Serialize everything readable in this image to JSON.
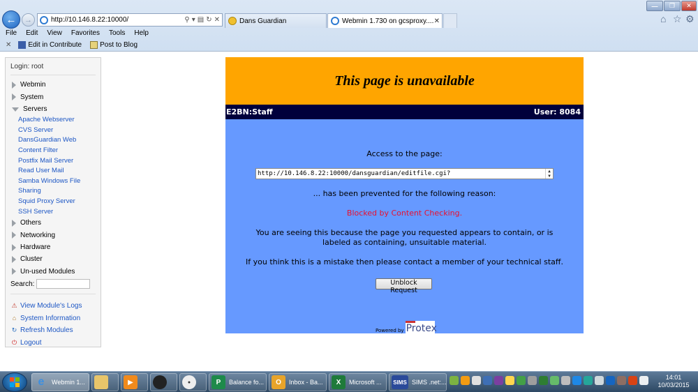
{
  "browser": {
    "address_url": "http://10.146.8.22:10000/",
    "tabs": [
      {
        "label": "Dans Guardian",
        "active": false
      },
      {
        "label": "Webmin 1.730 on gcsproxy....",
        "active": true
      }
    ],
    "menu": [
      "File",
      "Edit",
      "View",
      "Favorites",
      "Tools",
      "Help"
    ],
    "favorites": [
      "Edit in Contribute",
      "Post to Blog"
    ]
  },
  "sidebar": {
    "login": "Login: root",
    "categories_top": [
      {
        "label": "Webmin",
        "open": false
      },
      {
        "label": "System",
        "open": false
      },
      {
        "label": "Servers",
        "open": true
      }
    ],
    "server_items": [
      "Apache Webserver",
      "CVS Server",
      "DansGuardian Web",
      "Content Filter",
      "Postfix Mail Server",
      "Read User Mail",
      "Samba Windows File",
      "Sharing",
      "Squid Proxy Server",
      "SSH Server"
    ],
    "categories_bottom": [
      {
        "label": "Others"
      },
      {
        "label": "Networking"
      },
      {
        "label": "Hardware"
      },
      {
        "label": "Cluster"
      },
      {
        "label": "Un-used Modules"
      }
    ],
    "search_label": "Search:",
    "tools": [
      {
        "label": "View Module's Logs",
        "icon": "warning-icon"
      },
      {
        "label": "System Information",
        "icon": "home-icon"
      },
      {
        "label": "Refresh Modules",
        "icon": "refresh-icon"
      },
      {
        "label": "Logout",
        "icon": "power-icon"
      }
    ]
  },
  "block_page": {
    "title": "This page is unavailable",
    "bar_left": "E2BN:Staff",
    "bar_right": "User: 8084",
    "access_text": "Access to the page:",
    "blocked_url": "http://10.146.8.22:10000/dansguardian/editfile.cgi?",
    "prevented_text": "... has been prevented for the following reason:",
    "reason": "Blocked by Content Checking.",
    "explanation": "You are seeing this because the page you requested appears to contain, or is labeled as containing, unsuitable material.",
    "mistake_text": "If you think this is a mistake then please contact a member of your technical staff.",
    "unblock_label": "Unblock Request",
    "powered_by": "Powered by",
    "logo_text": "Protex",
    "colors": {
      "header": "#ffa500",
      "bar": "#00003b",
      "body": "#6699ff",
      "reason": "#e8102f"
    }
  },
  "taskbar": {
    "buttons": [
      {
        "label": "Webmin 1...",
        "icon": "ie-icon",
        "active": true
      },
      {
        "label": "",
        "icon": "folder-icon"
      },
      {
        "label": "",
        "icon": "media-icon"
      },
      {
        "label": "",
        "icon": "app-icon"
      },
      {
        "label": "",
        "icon": "cisco-icon"
      },
      {
        "label": "Balance fo...",
        "icon": "publisher-icon"
      },
      {
        "label": "Inbox - Ba...",
        "icon": "outlook-icon"
      },
      {
        "label": "Microsoft ...",
        "icon": "excel-icon"
      },
      {
        "label": "SIMS .net:...",
        "icon": "sims-icon"
      }
    ],
    "clock_time": "14:01",
    "clock_date": "10/03/2015"
  }
}
